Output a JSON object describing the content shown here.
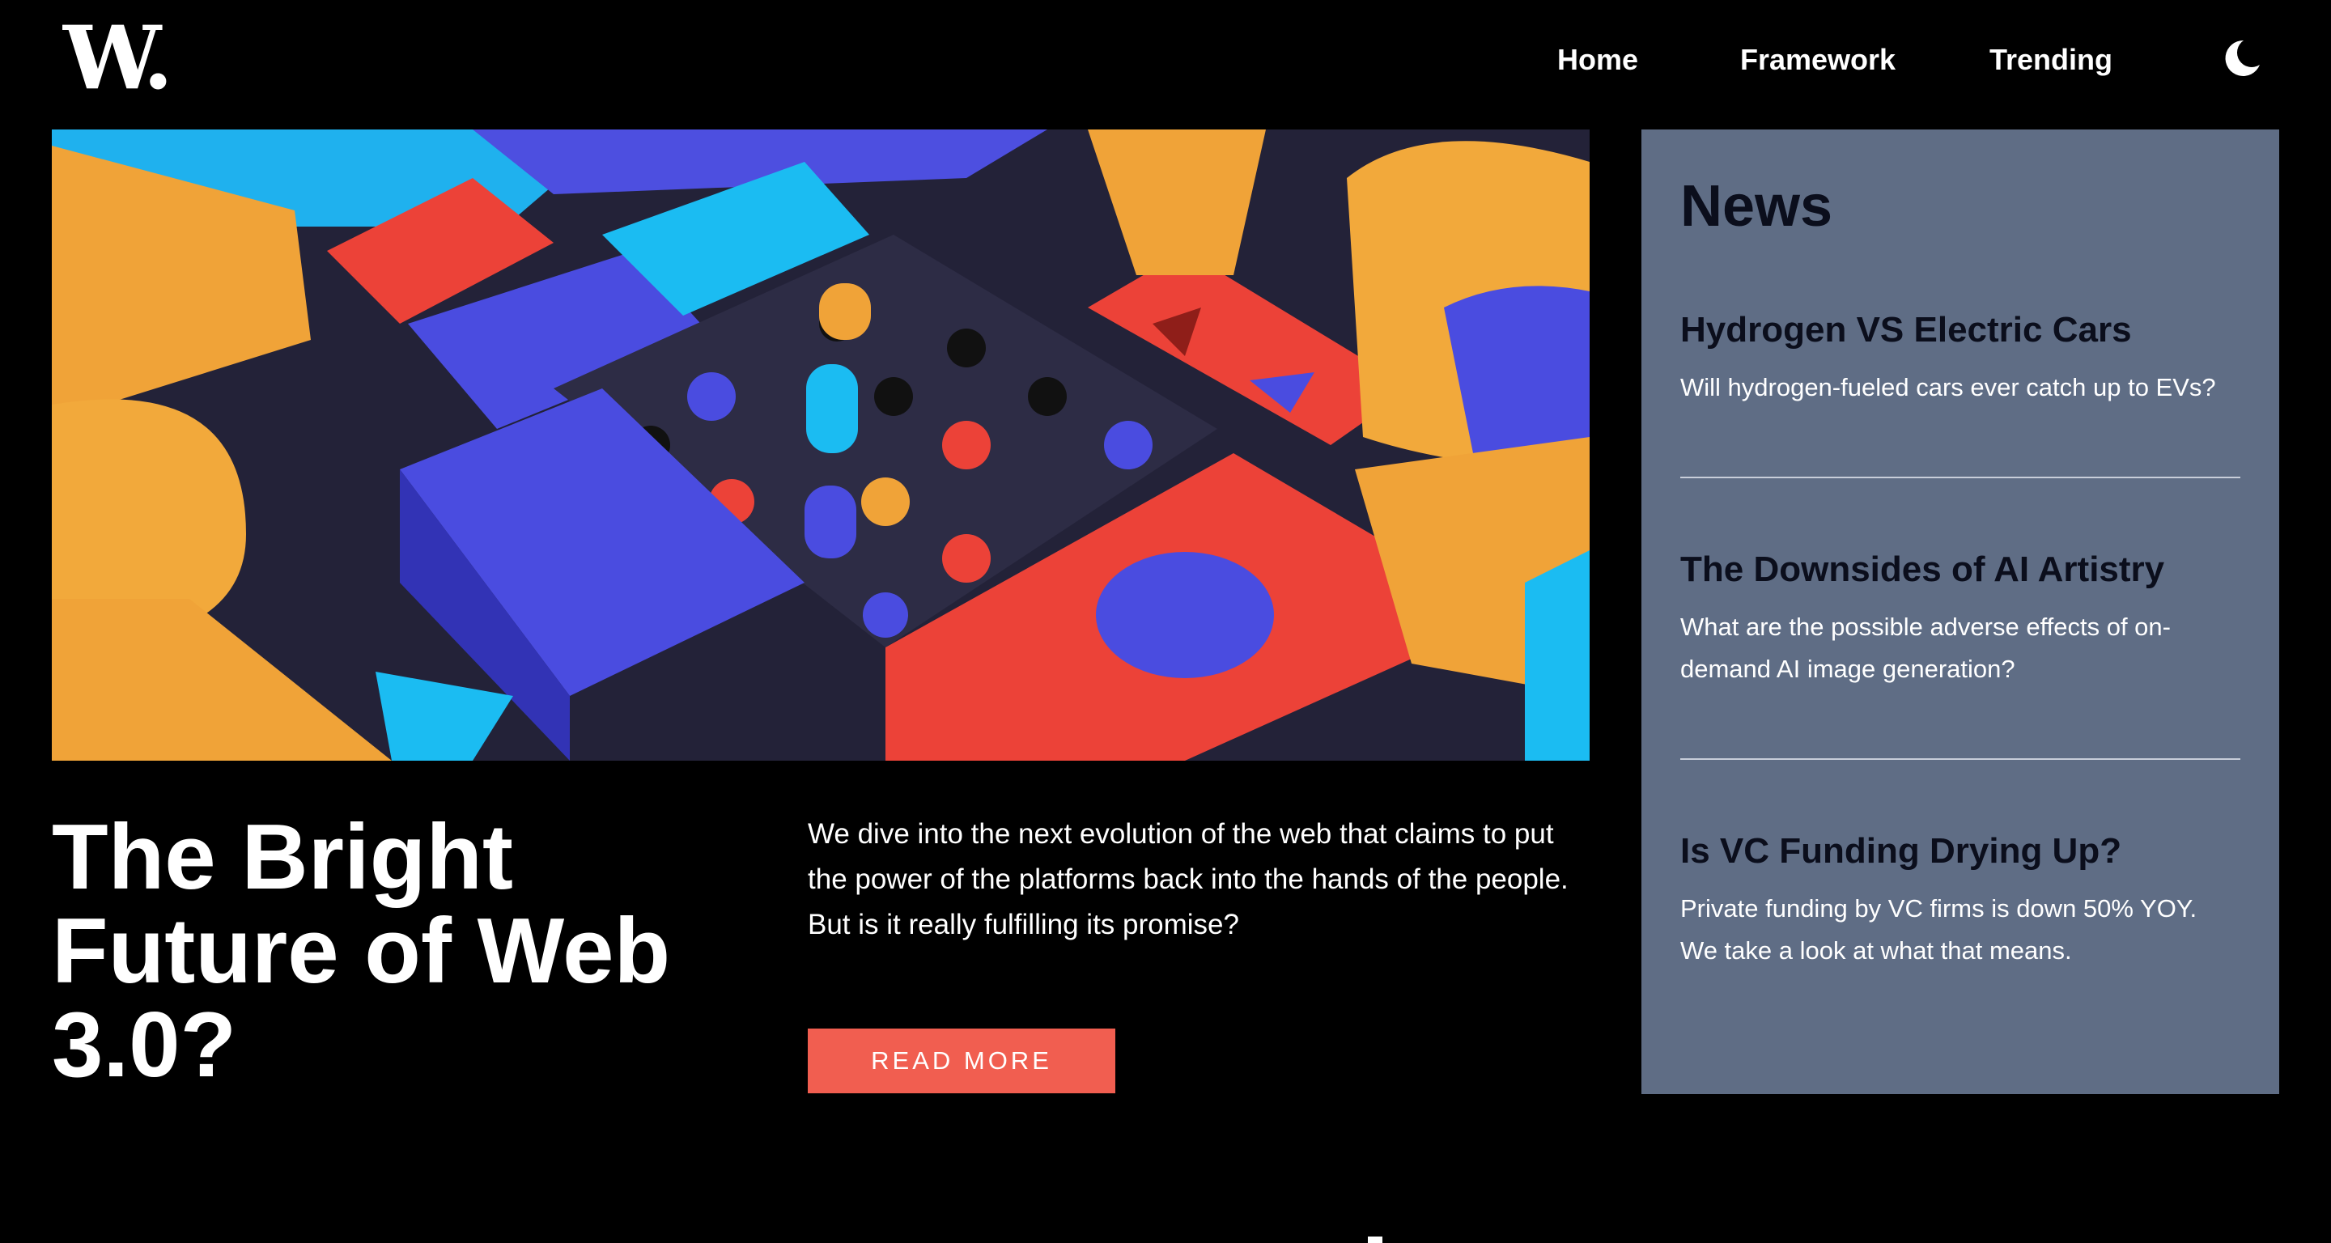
{
  "header": {
    "logo": "W.",
    "nav": [
      {
        "label": "Home"
      },
      {
        "label": "Framework"
      },
      {
        "label": "Trending"
      }
    ],
    "theme_toggle_icon": "moon-icon"
  },
  "hero": {
    "image_icon": "abstract-3d-blocks-image",
    "headline": "The Bright Future of Web 3.0?",
    "description": "We dive into the next evolution of the web that claims to put the power of the platforms back into the hands of the people. But is it really fulfilling its promise?",
    "cta_label": "READ MORE"
  },
  "news": {
    "title": "News",
    "items": [
      {
        "title": "Hydrogen VS Electric Cars",
        "summary": "Will hydrogen-fueled cars ever catch up to EVs?"
      },
      {
        "title": "The Downsides of AI Artistry",
        "summary": "What are the possible adverse effects of on-demand AI image generation?"
      },
      {
        "title": "Is VC Funding Drying Up?",
        "summary": "Private funding by VC firms is down 50% YOY. We take a look at what that means."
      }
    ]
  },
  "colors": {
    "background": "#000000",
    "accent": "#f15e50",
    "news_panel": "#5f6d85",
    "news_heading": "#0b0e1c"
  }
}
